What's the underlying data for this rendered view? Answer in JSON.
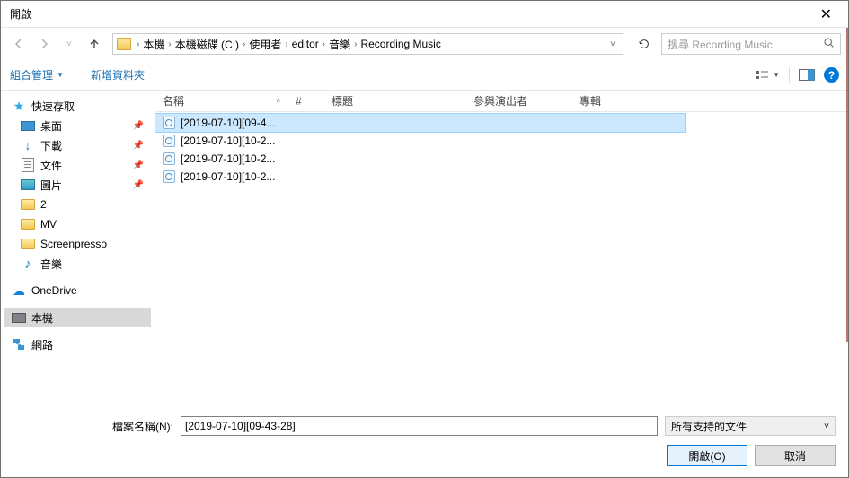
{
  "title": "開啟",
  "breadcrumbs": [
    "本機",
    "本機磁碟 (C:)",
    "使用者",
    "editor",
    "音樂",
    "Recording Music"
  ],
  "search_placeholder": "搜尋 Recording Music",
  "toolbar": {
    "organize": "組合管理",
    "new_folder": "新增資料夾"
  },
  "sidebar": {
    "quick_access": "快速存取",
    "desktop": "桌面",
    "downloads": "下載",
    "documents": "文件",
    "pictures": "圖片",
    "folder2": "2",
    "mv": "MV",
    "screenpresso": "Screenpresso",
    "music": "音樂",
    "onedrive": "OneDrive",
    "this_pc": "本機",
    "network": "網路"
  },
  "columns": {
    "name": "名稱",
    "num": "#",
    "title": "標題",
    "artist": "參與演出者",
    "album": "專輯"
  },
  "files": [
    {
      "name": "[2019-07-10][09-4...",
      "selected": true
    },
    {
      "name": "[2019-07-10][10-2...",
      "selected": false
    },
    {
      "name": "[2019-07-10][10-2...",
      "selected": false
    },
    {
      "name": "[2019-07-10][10-2...",
      "selected": false
    }
  ],
  "filename_label": "檔案名稱(N):",
  "filename_value": "[2019-07-10][09-43-28]",
  "filetype": "所有支持的文件",
  "open_btn": "開啟(O)",
  "cancel_btn": "取消"
}
